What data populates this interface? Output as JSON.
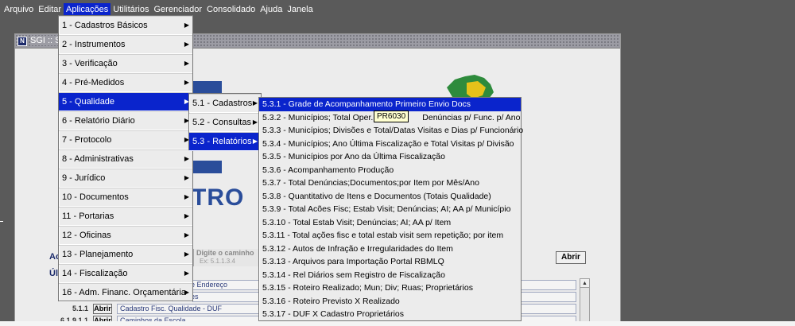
{
  "menubar": {
    "items": [
      "Arquivo",
      "Editar",
      "Aplicações",
      "Utilitários",
      "Gerenciador",
      "Consolidado",
      "Ajuda",
      "Janela"
    ],
    "active_index": 2
  },
  "window": {
    "title": "SGI :: S",
    "icon_letter": "N"
  },
  "logo": {
    "text": "TRO"
  },
  "content": {
    "acoes_label": "Ac",
    "ult_label": "Úl",
    "path_input_label": "Digite o caminho",
    "path_input_hint": "Ex: 5.1.1.3.4",
    "abrir_label": "Abrir",
    "list_fields": [
      "de Endereço",
      "ões",
      "Cadastro Fisc. Qualidade - DUF",
      "Caminhos da Escola"
    ],
    "rows": [
      {
        "code": "5.1.1",
        "abrir": "Abrir"
      },
      {
        "code": "6.1.9.1.1",
        "abrir": "Abrir"
      }
    ]
  },
  "menus": {
    "aplicacoes": [
      "1 - Cadastros Básicos",
      "2 - Instrumentos",
      "3 - Verificação",
      "4 - Pré-Medidos",
      "5 - Qualidade",
      "6 - Relatório Diário",
      "7 - Protocolo",
      "8 - Administrativas",
      "9 - Jurídico",
      "10 - Documentos",
      "11 - Portarias",
      "12 - Oficinas",
      "13 - Planejamento",
      "14 - Fiscalização",
      "16 - Adm. Financ. Orçamentária"
    ],
    "aplicacoes_selected": 4,
    "qualidade": [
      "5.1 - Cadastros",
      "5.2 - Consultas",
      "5.3 - Relatórios"
    ],
    "qualidade_selected": 2,
    "relatorios": [
      "5.3.1 - Grade de Acompanhamento Primeiro Envio Docs",
      "5.3.2 - Municípios; Total Oper.",
      "5.3.3 - Municípios; Divisões e Total/Datas Visitas e Dias p/ Funcionário",
      "5.3.4 - Municípios; Ano Última Fiscalização e Total Visitas p/ Divisão",
      "5.3.5 - Municípios por Ano da Última Fiscalização",
      "5.3.6 - Acompanhamento Produção",
      "5.3.7 - Total Denúncias;Documentos;por Item por Mês/Ano",
      "5.3.8 - Quantitativo de Itens e Documentos (Totais Qualidade)",
      "5.3.9 - Total Acões Fisc; Estab Visit; Denúncias; AI; AA p/ Município",
      "5.3.10 - Total Estab Visit; Denúncias; AI; AA p/ Item",
      "5.3.11 - Total ações fisc e total estab visit sem repetição; por item",
      "5.3.12 - Autos de Infração e Irregularidades do Item",
      "5.3.13 - Arquivos para Importação Portal RBMLQ",
      "5.3.14 - Rel Diários sem Registro de Fiscalização",
      "5.3.15 - Roteiro Realizado; Mun; Div; Ruas; Proprietários",
      "5.3.16 - Roteiro Previsto X Realizado",
      "5.3.17 - DUF X Cadastro Proprietários"
    ],
    "relatorios_item2_suffix": "Denúncias p/ Func. p/ Ano",
    "relatorios_selected": 0
  },
  "tooltip": {
    "text": "PR6030"
  },
  "colors": {
    "selection": "#0a24cc",
    "logo_blue": "#2a4d9a",
    "menubar_bg": "#5a5a5a"
  }
}
